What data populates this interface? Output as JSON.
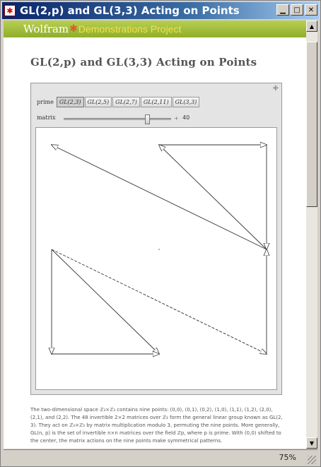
{
  "window": {
    "title": "GL(2,p) and GL(3,3) Acting on Points",
    "app_icon": "mathematica-star-icon",
    "buttons": [
      "minimize",
      "maximize",
      "close"
    ]
  },
  "banner": {
    "brand": "Wolfram",
    "star": "✱",
    "product": "Demonstrations Project"
  },
  "page": {
    "title": "GL(2,p) and GL(3,3) Acting on Points"
  },
  "controls": {
    "tabs_label": "prime",
    "tabs": [
      "GL(2,3)",
      "GL(2,5)",
      "GL(2,7)",
      "GL(2,11)",
      "GL(3,3)"
    ],
    "active_tab_index": 0,
    "slider_label": "matrix",
    "slider_value": "40",
    "slider_fraction": 0.79,
    "plus_symbol": "+"
  },
  "plot": {
    "type": "arrow-diagram",
    "points": [
      [
        0,
        0
      ],
      [
        0,
        1
      ],
      [
        0,
        2
      ],
      [
        1,
        0
      ],
      [
        1,
        1
      ],
      [
        1,
        2
      ],
      [
        2,
        0
      ],
      [
        2,
        1
      ],
      [
        2,
        2
      ]
    ],
    "arrows": [
      {
        "from": [
          2,
          1
        ],
        "to": [
          0,
          2
        ],
        "dashed": false
      },
      {
        "from": [
          2,
          1
        ],
        "to": [
          1,
          2
        ],
        "dashed": false
      },
      {
        "from": [
          2,
          2
        ],
        "to": [
          2,
          1
        ],
        "dashed": false
      },
      {
        "from": [
          1,
          2
        ],
        "to": [
          2,
          2
        ],
        "dashed": false
      },
      {
        "from": [
          0,
          1
        ],
        "to": [
          1,
          0
        ],
        "dashed": false
      },
      {
        "from": [
          0,
          1
        ],
        "to": [
          0,
          0
        ],
        "dashed": false
      },
      {
        "from": [
          0,
          0
        ],
        "to": [
          1,
          0
        ],
        "dashed": false
      },
      {
        "from": [
          0,
          1
        ],
        "to": [
          2,
          0
        ],
        "dashed": true
      },
      {
        "from": [
          2,
          0
        ],
        "to": [
          2,
          1
        ],
        "dashed": false
      }
    ]
  },
  "description": "The two-dimensional space ℤ₃×ℤ₃ contains nine points: (0,0), (0,1), (0,2), (1,0), (1,1), (1,2), (2,0), (2,1), and (2,2). The 48 invertible 2×2 matrices over ℤ₃ form the general linear group known as GL(2, 3). They act on ℤ₃×ℤ₃ by matrix multiplication modulo 3, permuting the nine points. More generally, GL(n, p) is the set of invertible n×n matrices over the field ℤp, where p is prime. With (0,0) shifted to the center, the matrix actions on the nine points make symmetrical patterns.",
  "status": {
    "zoom": "75%"
  }
}
